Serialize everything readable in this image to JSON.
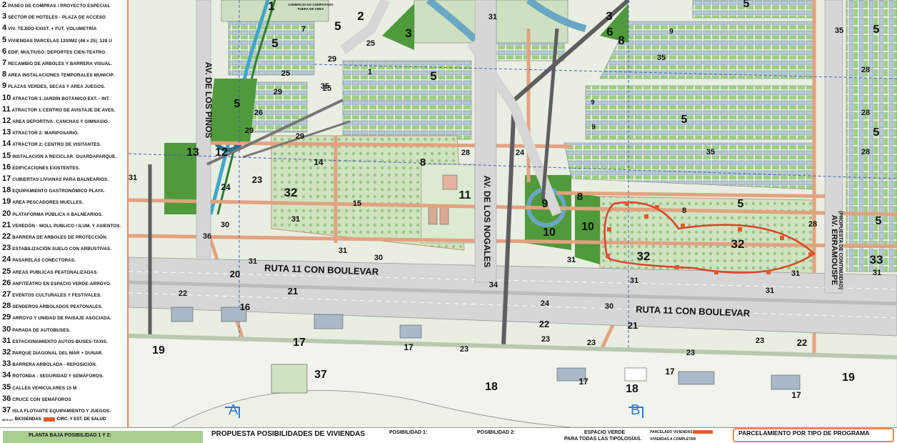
{
  "legend": {
    "items": [
      {
        "num": "2",
        "text": "PASEO DE COMPRAS / PROYECTO ESPECIAL"
      },
      {
        "num": "3",
        "text": "SECTOR DE HOTELES - PLAZA DE ACCESO"
      },
      {
        "num": "4",
        "text": "VIV. TEJIDO EXIST. + FUT. VOLUMETRÍA"
      },
      {
        "num": "5",
        "text": "VIVIENDAS PARCELAS 1200M2 (48 x 25)_128 U"
      },
      {
        "num": "6",
        "text": "EDIF. MULTIUSO: DEPORTES CIEN-TEATRO."
      },
      {
        "num": "7",
        "text": "RECAMBIO DE ARBOLES Y BARRERA VISUAL."
      },
      {
        "num": "8",
        "text": "AREA INSTALACIONES TEMPORALES MUNICIP."
      },
      {
        "num": "9",
        "text": "PLAZAS VERDES, SECAS Y AREA JUEGOS."
      },
      {
        "num": "10",
        "text": "ATRACTOR 1:JARDÍN BOTÁNICO EXT. - INT."
      },
      {
        "num": "11",
        "text": "ATRACTOR 1:CENTRO DE AVISTAJE DE AVES."
      },
      {
        "num": "12",
        "text": "AREA DEPORTIVA: CANCHAS Y GIMNASIO."
      },
      {
        "num": "13",
        "text": "ATRACTOR 2: MARIPOSARIO."
      },
      {
        "num": "14",
        "text": "ATRACTOR 2: CENTRO DE VISITANTES."
      },
      {
        "num": "15",
        "text": "INSTALACIÓN A RECICLAR: GUARDAPARQUE."
      },
      {
        "num": "16",
        "text": "EDIFICACIONES EXISTENTES."
      },
      {
        "num": "17",
        "text": "CUBIERTAS LIVIANAS PARA BALNEARIOS."
      },
      {
        "num": "18",
        "text": "EQUIPAMIENTO GASTRONÓMICO PLAYA."
      },
      {
        "num": "19",
        "text": "AREA PESCADORES MUELLES."
      },
      {
        "num": "20",
        "text": "PLATAFORMA PÚBLICA A BALNEARIOS."
      },
      {
        "num": "21",
        "text": "VEREDÓN - MOLL PUBLICO / ILUM. Y ASIENTOS."
      },
      {
        "num": "22",
        "text": "BARRERA DE ARBOLES DE PROTECCIÓN."
      },
      {
        "num": "23",
        "text": "ESTABILIZACIÓN SUELO CON ARBUSTIVAS."
      },
      {
        "num": "24",
        "text": "PASARELAS CONECTORAS."
      },
      {
        "num": "25",
        "text": "AREAS PUBLICAS PEATONALIZADAS."
      },
      {
        "num": "26",
        "text": "ANFITEATRO EN ESPACIO VERDE-ARROYO."
      },
      {
        "num": "27",
        "text": "EVENTOS CULTURALES Y FESTIVALES."
      },
      {
        "num": "28",
        "text": "SENDEROS ARBOLADOS PEATONALES."
      },
      {
        "num": "29",
        "text": "ARROYO Y UNIDAD DE PAISAJE ASOCIADA."
      },
      {
        "num": "30",
        "text": "PARADA DE AUTOBUSES."
      },
      {
        "num": "31",
        "text": "ESTACIONAMIENTO AUTOS-BUSES-TAXIS."
      },
      {
        "num": "32",
        "text": "PARQUE DIAGONAL DEL MAR + DUNAR."
      },
      {
        "num": "33",
        "text": "BARRERA ARBOLADA - REPOSICIÓN."
      },
      {
        "num": "34",
        "text": "ROTONDA : SEGURIDAD Y SEMÁFOROS."
      },
      {
        "num": "35",
        "text": "CALLES VEHICULARES 15 M"
      },
      {
        "num": "36",
        "text": "CRUCE CON SEMÁFOROS"
      },
      {
        "num": "37",
        "text": "ISLA FLOTANTE EQUIPAMIENTO Y JUEGOS."
      }
    ],
    "bicisendas_label": "BICISENDAS",
    "salud_label": "CIRC. Y EST. DE SALUD",
    "bici_small": "5870 ml",
    "salud_small": "3500 m2"
  },
  "map": {
    "streets": {
      "pinos": "AV. DE LOS PINOS",
      "nogales": "AV. DE LOS NOGALES",
      "erramouspe": "AV. ERRAMOUSPE",
      "erramouspe_note": "(PROPUESTA DE CONTINUIDAD)",
      "ruta_1": "RUTA 11 CON BOULEVAR",
      "ruta_2": "RUTA 11 CON BOULEVAR"
    },
    "top_note_1": "COMERCIO NO COMPUTADO",
    "top_note_2": "FUERA DE AREA",
    "section_a": "A",
    "section_b": "B",
    "labels": [
      "1",
      "1",
      "2",
      "3",
      "3",
      "3",
      "5",
      "5",
      "5",
      "5",
      "5",
      "5",
      "5",
      "5",
      "5",
      "5",
      "5",
      "6",
      "7",
      "8",
      "8",
      "8",
      "8",
      "9",
      "9",
      "9",
      "9",
      "9",
      "10",
      "10",
      "11",
      "12",
      "13",
      "14",
      "15",
      "16",
      "17",
      "17",
      "17",
      "17",
      "17",
      "17",
      "18",
      "18",
      "19",
      "19",
      "20",
      "21",
      "21",
      "22",
      "22",
      "22",
      "23",
      "23",
      "23",
      "23",
      "23",
      "23",
      "23",
      "24",
      "24",
      "24",
      "25",
      "25",
      "25",
      "26",
      "28",
      "28",
      "28",
      "28",
      "28",
      "28",
      "29",
      "29",
      "29",
      "29",
      "30",
      "30",
      "30",
      "31",
      "31",
      "31",
      "31",
      "31",
      "31",
      "31",
      "31",
      "31",
      "31",
      "31",
      "31",
      "32",
      "32",
      "32",
      "33",
      "34",
      "35",
      "35",
      "35",
      "35",
      "36",
      "37"
    ]
  },
  "bottom": {
    "planta_label": "PLANTA BAJA POSIBILIDAD 1 Y 2:",
    "propuesta_title": "PROPUESTA POSIBILIDADES DE VIVIENDAS",
    "posibilidad_1": "POSIBILIDAD 1:",
    "posibilidad_2": "POSIBILIDAD 2:",
    "espacio_verde_1": "ESPACIO VERDE",
    "espacio_verde_2": "PARA TODAS LAS TIPOLOGÍAS.",
    "parcelado": "PARCELADO VIVIENDAS",
    "viviendas_completar": "VIVIENDAS A COMPLETAR",
    "parcelamiento_title": "PARCELAMIENTO POR TIPO DE PROGRAMA"
  },
  "colors": {
    "road": "#d6d6d6",
    "orange_path": "#e3a27f",
    "green": "#4f9a3a",
    "light_green": "#a9cf90",
    "pale_green": "#d8e8c8",
    "park": "#cfe3c0",
    "beach": "#f3f3ee",
    "building": "#9fb3c2",
    "red_loop": "#d9442b",
    "blue_marker": "#2d7ad6",
    "dark_line": "#444444"
  }
}
